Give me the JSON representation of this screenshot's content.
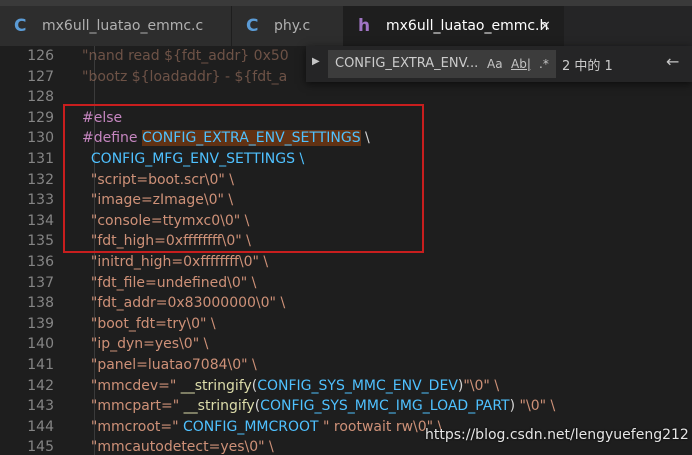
{
  "tabs": [
    {
      "icon": "C",
      "icon_color": "#5b9bd5",
      "label": "mx6ull_luatao_emmc.c",
      "active": false
    },
    {
      "icon": "C",
      "icon_color": "#5b9bd5",
      "label": "phy.c",
      "active": false
    },
    {
      "icon": "h",
      "icon_color": "#a074c4",
      "label": "mx6ull_luatao_emmc.h",
      "active": true,
      "close": "×"
    }
  ],
  "find": {
    "value": "CONFIG_EXTRA_ENV...",
    "match_case": "Aa",
    "whole_word": "Ab|",
    "regex": ".*",
    "count": "2 中的 1",
    "prev": "←"
  },
  "lines": [
    {
      "n": "126",
      "segs": [
        {
          "t": "\"nand read ${fdt_addr} 0x50",
          "c": "k-str k-dim"
        }
      ]
    },
    {
      "n": "127",
      "segs": [
        {
          "t": "\"bootz ${loadaddr} - ${fdt_a",
          "c": "k-str k-dim"
        }
      ]
    },
    {
      "n": "128",
      "segs": []
    },
    {
      "n": "129",
      "segs": [
        {
          "t": "#else",
          "c": "k-dir"
        }
      ]
    },
    {
      "n": "130",
      "segs": [
        {
          "t": "#define ",
          "c": "k-dir"
        },
        {
          "t": "CONFIG_EXTRA_ENV_SETTINGS",
          "c": "k-macro k-hl"
        },
        {
          "t": " \\",
          "c": "k-plain"
        }
      ]
    },
    {
      "n": "131",
      "segs": [
        {
          "t": "  CONFIG_MFG_ENV_SETTINGS \\",
          "c": "k-macro"
        }
      ]
    },
    {
      "n": "132",
      "segs": [
        {
          "t": "  \"script=boot.scr\\0\" \\",
          "c": "k-str"
        }
      ]
    },
    {
      "n": "133",
      "segs": [
        {
          "t": "  \"image=zImage\\0\" \\",
          "c": "k-str"
        }
      ]
    },
    {
      "n": "134",
      "segs": [
        {
          "t": "  \"console=ttymxc0\\0\" \\",
          "c": "k-str"
        }
      ]
    },
    {
      "n": "135",
      "segs": [
        {
          "t": "  \"fdt_high=0xffffffff\\0\" \\",
          "c": "k-str"
        }
      ]
    },
    {
      "n": "136",
      "segs": [
        {
          "t": "  \"initrd_high=0xffffffff\\0\" \\",
          "c": "k-str"
        }
      ]
    },
    {
      "n": "137",
      "segs": [
        {
          "t": "  \"fdt_file=undefined\\0\" \\",
          "c": "k-str"
        }
      ]
    },
    {
      "n": "138",
      "segs": [
        {
          "t": "  \"fdt_addr=0x83000000\\0\" \\",
          "c": "k-str"
        }
      ]
    },
    {
      "n": "139",
      "segs": [
        {
          "t": "  \"boot_fdt=try\\0\" \\",
          "c": "k-str"
        }
      ]
    },
    {
      "n": "140",
      "segs": [
        {
          "t": "  \"ip_dyn=yes\\0\" \\",
          "c": "k-str"
        }
      ]
    },
    {
      "n": "141",
      "segs": [
        {
          "t": "  \"panel=luatao7084\\0\" \\",
          "c": "k-str"
        }
      ]
    },
    {
      "n": "142",
      "segs": [
        {
          "t": "  \"mmcdev=\" ",
          "c": "k-str"
        },
        {
          "t": "__stringify",
          "c": "k-fn"
        },
        {
          "t": "(",
          "c": "k-plain"
        },
        {
          "t": "CONFIG_SYS_MMC_ENV_DEV",
          "c": "k-macro"
        },
        {
          "t": ")",
          "c": "k-plain"
        },
        {
          "t": "\"\\0\" \\",
          "c": "k-str"
        }
      ]
    },
    {
      "n": "143",
      "segs": [
        {
          "t": "  \"mmcpart=\" ",
          "c": "k-str"
        },
        {
          "t": "__stringify",
          "c": "k-fn"
        },
        {
          "t": "(",
          "c": "k-plain"
        },
        {
          "t": "CONFIG_SYS_MMC_IMG_LOAD_PART",
          "c": "k-macro"
        },
        {
          "t": ") ",
          "c": "k-plain"
        },
        {
          "t": "\"\\0\" \\",
          "c": "k-str"
        }
      ]
    },
    {
      "n": "144",
      "segs": [
        {
          "t": "  \"mmcroot=\" ",
          "c": "k-str"
        },
        {
          "t": "CONFIG_MMCROOT",
          "c": "k-macro"
        },
        {
          "t": " \" rootwait rw\\0\" \\",
          "c": "k-str"
        }
      ]
    },
    {
      "n": "145",
      "segs": [
        {
          "t": "  \"mmcautodetect=yes\\0\" \\",
          "c": "k-str"
        }
      ]
    }
  ],
  "watermark": "https://blog.csdn.net/lengyuefeng212",
  "colors": {
    "string": "#ce9178",
    "macro": "#4fc1ff",
    "directive": "#c586c0",
    "highlight_box": "#c81e1e"
  }
}
